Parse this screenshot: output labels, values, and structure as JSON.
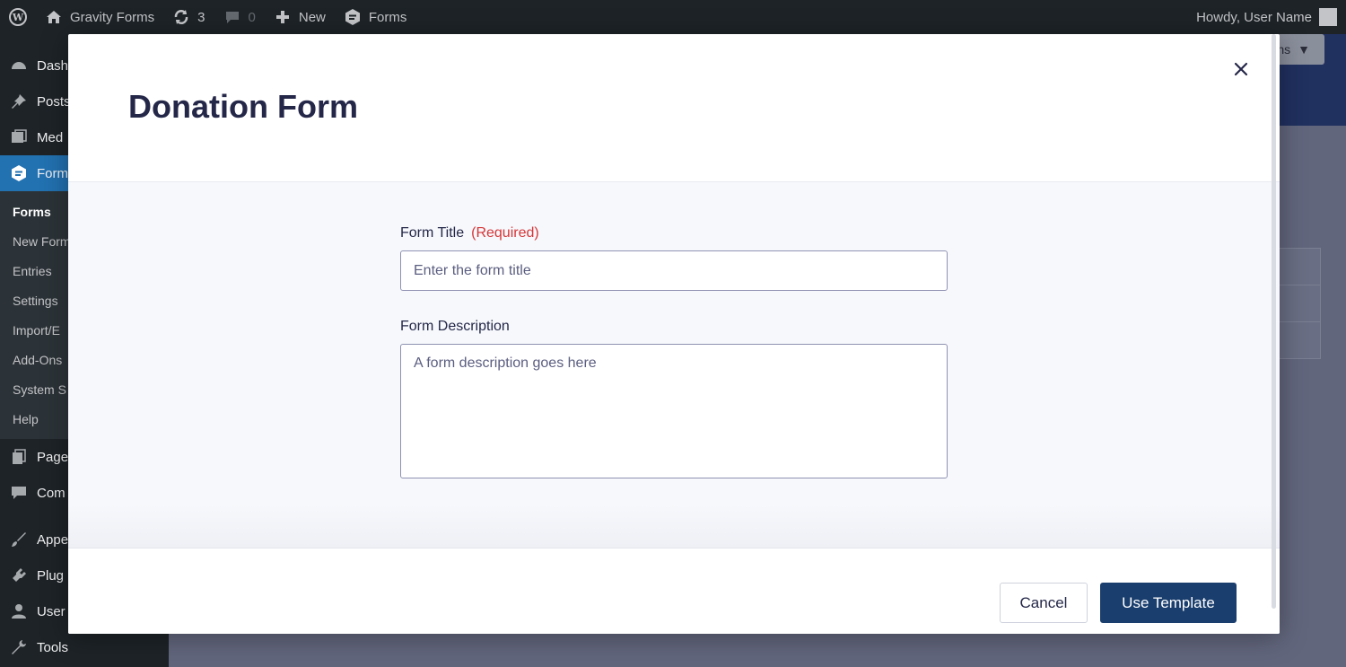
{
  "adminbar": {
    "site_name": "Gravity Forms",
    "updates_count": "3",
    "comments_count": "0",
    "new_label": "New",
    "forms_label": "Forms",
    "howdy": "Howdy, User Name"
  },
  "sidebar": {
    "items_top": [
      "Dash",
      "Posts",
      "Med",
      "Form"
    ],
    "submenu": [
      "Forms",
      "New Form",
      "Entries",
      "Settings",
      "Import/E",
      "Add-Ons",
      "System S",
      "Help"
    ],
    "items_bottom": [
      "Page",
      "Com",
      "Appe",
      "Plug",
      "User",
      "Tools"
    ]
  },
  "background": {
    "button_fragment": "ns"
  },
  "modal": {
    "title": "Donation Form",
    "form_title_label": "Form Title",
    "required_label": "(Required)",
    "form_title_placeholder": "Enter the form title",
    "form_description_label": "Form Description",
    "form_description_placeholder": "A form description goes here",
    "cancel_label": "Cancel",
    "use_template_label": "Use Template"
  },
  "colors": {
    "primary": "#1a3e6d",
    "required": "#d63638",
    "title": "#242748"
  }
}
